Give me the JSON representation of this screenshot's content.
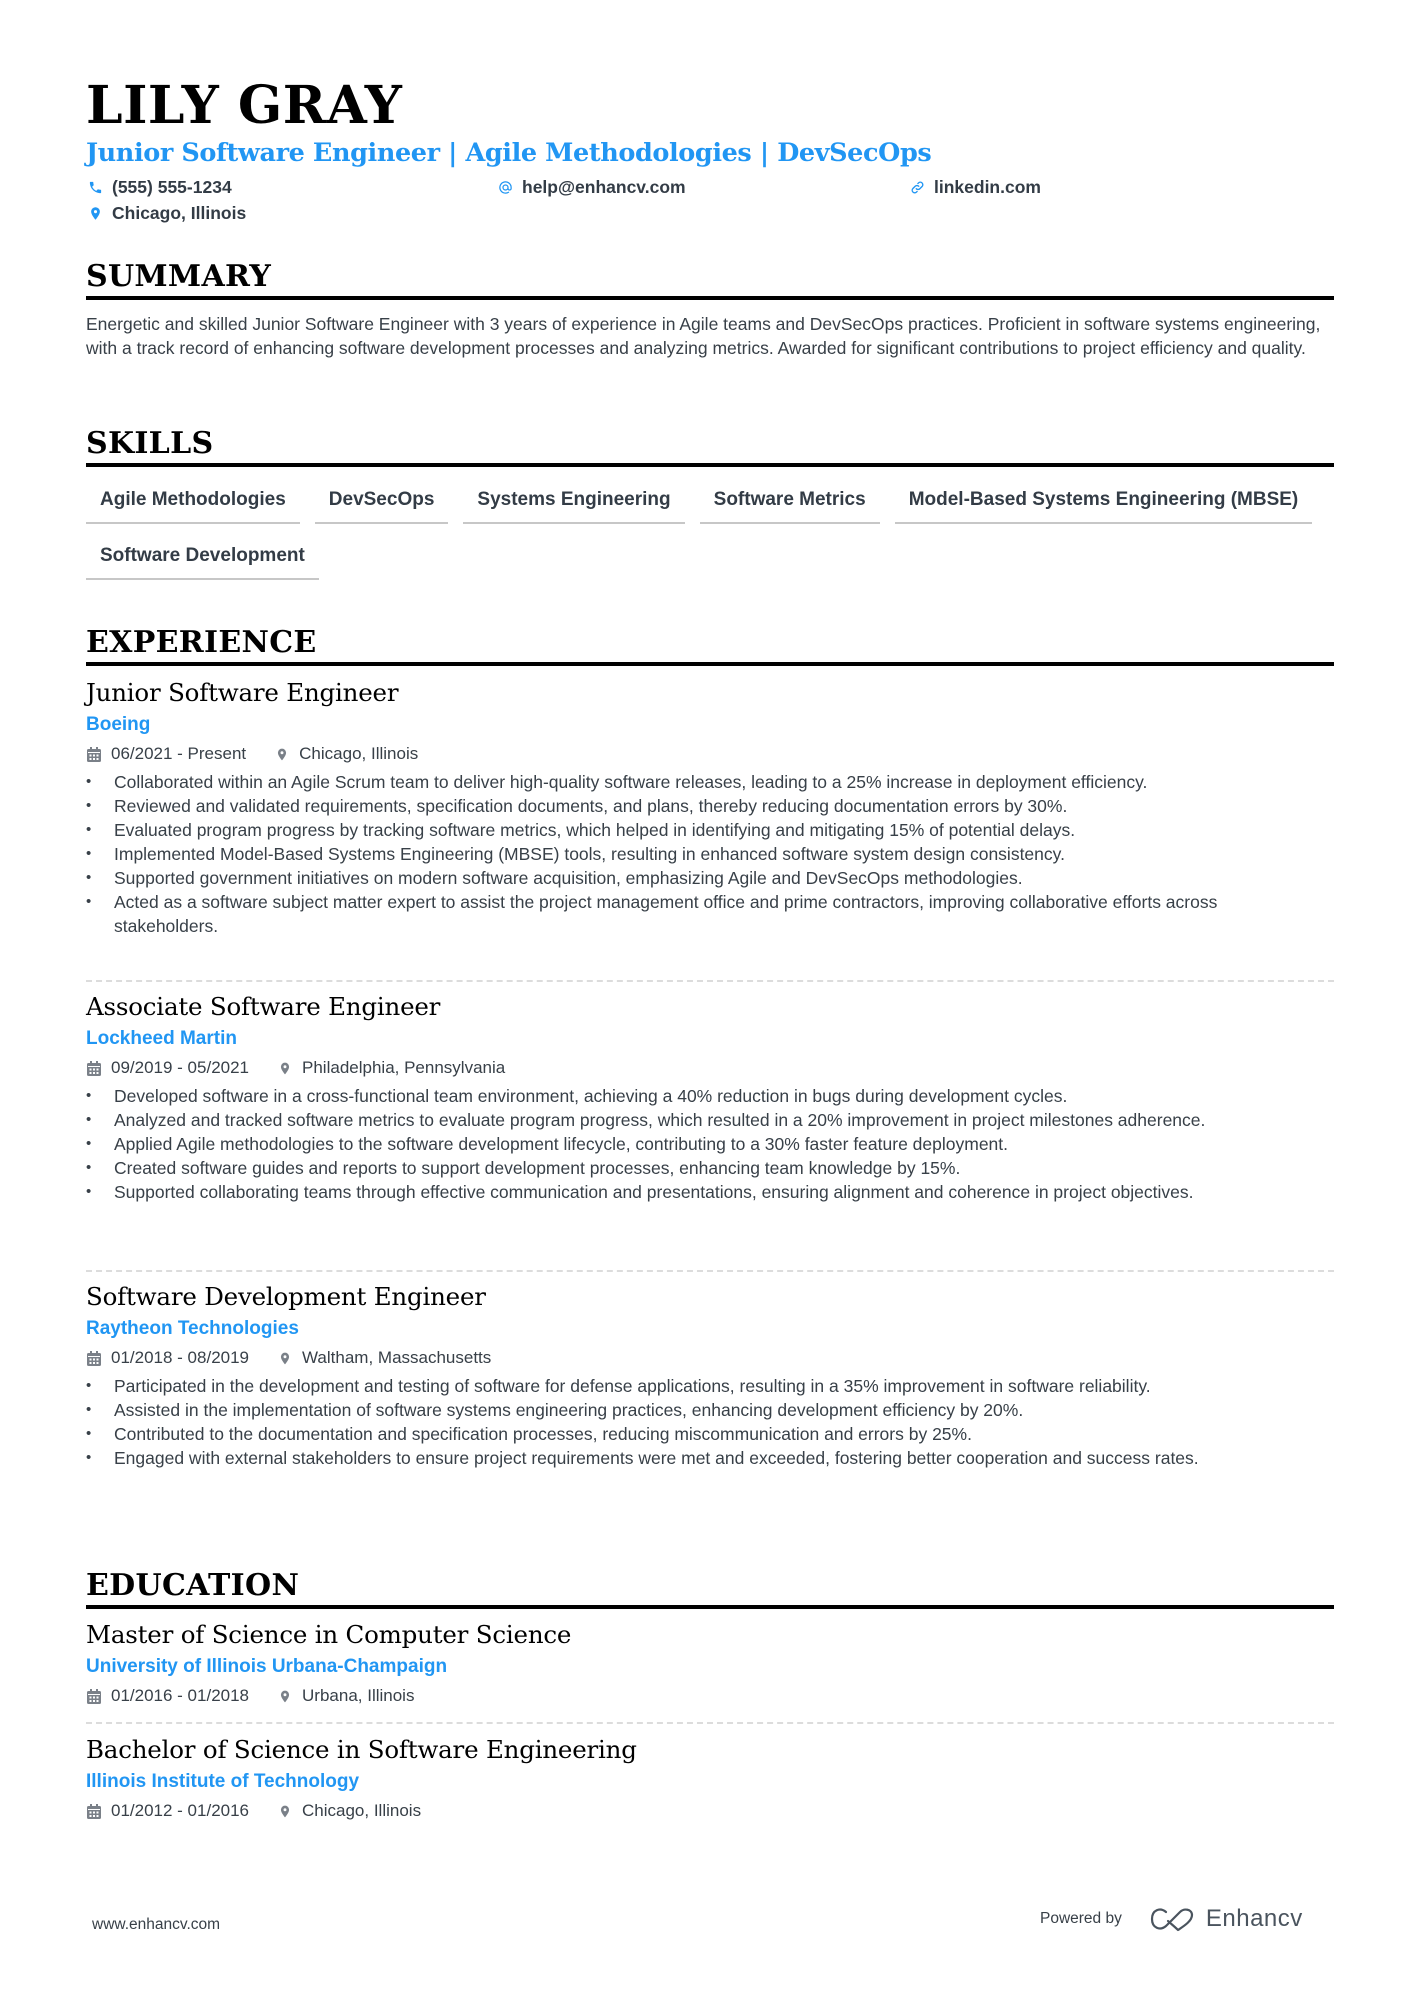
{
  "header": {
    "name": "LILY GRAY",
    "headline": "Junior Software Engineer | Agile Methodologies | DevSecOps",
    "contacts": {
      "phone": {
        "icon": "phone-icon",
        "text": "(555) 555-1234"
      },
      "email": {
        "icon": "at-icon",
        "text": "help@enhancv.com"
      },
      "link": {
        "icon": "link-icon",
        "text": "linkedin.com"
      },
      "location": {
        "icon": "location-pin-icon",
        "text": "Chicago, Illinois"
      }
    }
  },
  "colors": {
    "accent": "#2196f3",
    "text": "#384048",
    "heading": "#000000"
  },
  "summary": {
    "title": "SUMMARY",
    "text": "Energetic and skilled Junior Software Engineer with 3 years of experience in Agile teams and DevSecOps practices. Proficient in software systems engineering, with a track record of enhancing software development processes and analyzing metrics. Awarded for significant contributions to project efficiency and quality."
  },
  "skills": {
    "title": "SKILLS",
    "items": [
      "Agile Methodologies",
      "DevSecOps",
      "Systems Engineering",
      "Software Metrics",
      "Model-Based Systems Engineering (MBSE)",
      "Software Development"
    ]
  },
  "experience": {
    "title": "EXPERIENCE",
    "items": [
      {
        "role": "Junior Software Engineer",
        "company": "Boeing",
        "dates": "06/2021 - Present",
        "location": "Chicago, Illinois",
        "bullets": [
          "Collaborated within an Agile Scrum team to deliver high-quality software releases, leading to a 25% increase in deployment efficiency.",
          "Reviewed and validated requirements, specification documents, and plans, thereby reducing documentation errors by 30%.",
          "Evaluated program progress by tracking software metrics, which helped in identifying and mitigating 15% of potential delays.",
          "Implemented Model-Based Systems Engineering (MBSE) tools, resulting in enhanced software system design consistency.",
          "Supported government initiatives on modern software acquisition, emphasizing Agile and DevSecOps methodologies.",
          "Acted as a software subject matter expert to assist the project management office and prime contractors, improving collaborative efforts across stakeholders."
        ]
      },
      {
        "role": "Associate Software Engineer",
        "company": "Lockheed Martin",
        "dates": "09/2019 - 05/2021",
        "location": "Philadelphia, Pennsylvania",
        "bullets": [
          "Developed software in a cross-functional team environment, achieving a 40% reduction in bugs during development cycles.",
          "Analyzed and tracked software metrics to evaluate program progress, which resulted in a 20% improvement in project milestones adherence.",
          "Applied Agile methodologies to the software development lifecycle, contributing to a 30% faster feature deployment.",
          "Created software guides and reports to support development processes, enhancing team knowledge by 15%.",
          "Supported collaborating teams through effective communication and presentations, ensuring alignment and coherence in project objectives."
        ]
      },
      {
        "role": "Software Development Engineer",
        "company": "Raytheon Technologies",
        "dates": "01/2018 - 08/2019",
        "location": "Waltham, Massachusetts",
        "bullets": [
          "Participated in the development and testing of software for defense applications, resulting in a 35% improvement in software reliability.",
          "Assisted in the implementation of software systems engineering practices, enhancing development efficiency by 20%.",
          "Contributed to the documentation and specification processes, reducing miscommunication and errors by 25%.",
          "Engaged with external stakeholders to ensure project requirements were met and exceeded, fostering better cooperation and success rates."
        ]
      }
    ]
  },
  "education": {
    "title": "EDUCATION",
    "items": [
      {
        "degree": "Master of Science in Computer Science",
        "school": "University of Illinois Urbana-Champaign",
        "dates": "01/2016 - 01/2018",
        "location": "Urbana, Illinois"
      },
      {
        "degree": "Bachelor of Science in Software Engineering",
        "school": "Illinois Institute of Technology",
        "dates": "01/2012 - 01/2016",
        "location": "Chicago, Illinois"
      }
    ]
  },
  "footer": {
    "website": "www.enhancv.com",
    "powered_by": "Powered by",
    "brand": "Enhancv",
    "brand_icon": "enhancv-logo-icon"
  }
}
